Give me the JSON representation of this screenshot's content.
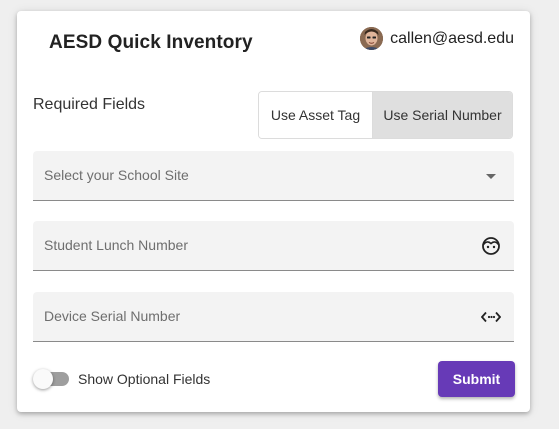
{
  "header": {
    "app_title": "AESD Quick Inventory",
    "user_email": "callen@aesd.edu"
  },
  "form": {
    "section_label": "Required Fields",
    "lookup_toggle": {
      "options": [
        "Use Asset Tag",
        "Use Serial Number"
      ],
      "selected": "Use Serial Number"
    },
    "school_site": {
      "placeholder": "Select your School Site",
      "icon": "chevron-down-icon"
    },
    "lunch_number": {
      "placeholder": "Student Lunch Number",
      "icon": "face-icon"
    },
    "serial_number": {
      "placeholder": "Device Serial Number",
      "icon": "code-icon"
    },
    "optional_toggle": {
      "label": "Show Optional Fields",
      "checked": false
    },
    "submit_label": "Submit"
  },
  "colors": {
    "accent": "#673ab7",
    "selected_toggle_bg": "#dfdfdf",
    "field_bg": "#f3f3f3"
  }
}
